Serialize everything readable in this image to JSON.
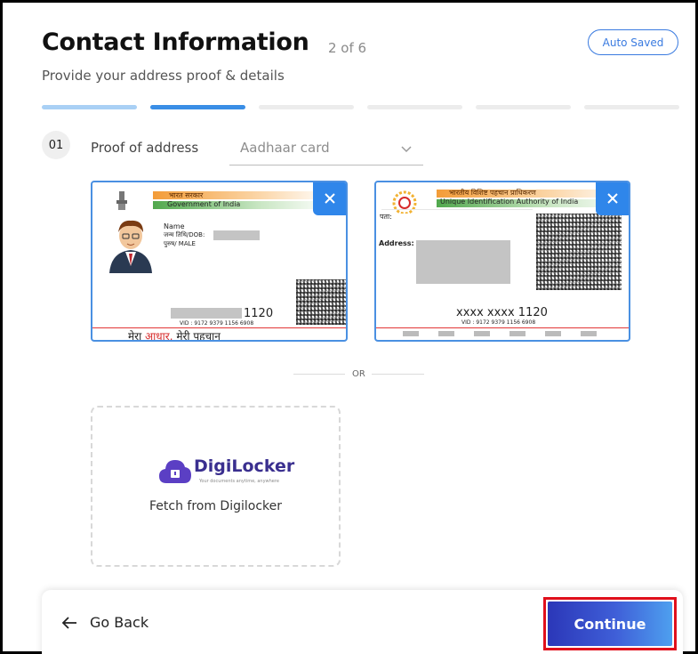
{
  "header": {
    "title": "Contact Information",
    "step_count": "2 of 6",
    "autosave_label": "Auto Saved",
    "subtitle": "Provide your address proof & details"
  },
  "progress": {
    "total_steps": 6,
    "current_step": 2,
    "colors": {
      "done": "#a9d0f5",
      "active": "#3a8ee6",
      "pending": "#ececec"
    }
  },
  "proof": {
    "step_number": "01",
    "label": "Proof of address",
    "selected_document": "Aadhaar card"
  },
  "front_card": {
    "hindi_gov": "भारत सरकार",
    "gov": "Government of India",
    "name_label": "Name",
    "dob_label": "जन्म तिथि/DOB:",
    "gender": "पुरुष/ MALE",
    "number_suffix": "1120",
    "vid": "VID : 9172 9379 1156 6908",
    "tagline_part1": "मेरा ",
    "tagline_part2": "आधार,",
    "tagline_part3": " मेरी पहचान"
  },
  "back_card": {
    "authority_hi": "भारतीय विशिष्ट पहचान प्राधिकरण",
    "authority_en": "Unique Identification Authority of India",
    "address_hi": "पता:",
    "address_label": "Address:",
    "number": "xxxx xxxx 1120",
    "vid": "VID : 9172 9379 1156 6908"
  },
  "divider_text": "OR",
  "digilocker": {
    "logo_text": "DigiLocker",
    "tagline": "Your documents anytime, anywhere",
    "caption": "Fetch from Digilocker"
  },
  "footer": {
    "back_label": "Go Back",
    "continue_label": "Continue"
  },
  "colors": {
    "accent": "#2f86ea",
    "highlight": "#e0101c",
    "digilocker": "#5b3fc4"
  }
}
